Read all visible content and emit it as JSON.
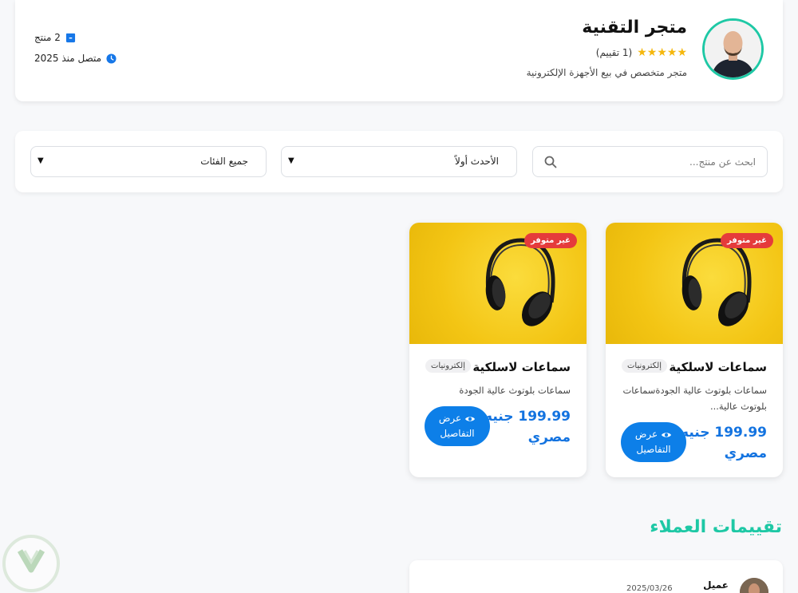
{
  "store": {
    "name": "متجر التقنية",
    "rating_count": "(1 تقييم)",
    "stars": "★★★★★",
    "description": "متجر متخصص في بيع الأجهزة الإلكترونية",
    "products_count": "2 منتج",
    "joined": "متصل منذ 2025",
    "accent_color": "#1ec8a5"
  },
  "filters": {
    "search_placeholder": "ابحث عن منتج...",
    "sort_selected": "الأحدث أولاً",
    "category_selected": "جميع الفئات"
  },
  "products": [
    {
      "badge": "غير متوفر",
      "title": "سماعات لاسلكية",
      "category": "إلكترونيات",
      "description": "سماعات بلوتوث عالية الجودةسماعات بلوتوث عالية...",
      "price": "199.99 جنيه مصري",
      "details_label_line1": "عرض",
      "details_label_line2": "التفاصيل"
    },
    {
      "badge": "غير متوفر",
      "title": "سماعات لاسلكية",
      "category": "إلكترونيات",
      "description": "سماعات بلوتوث عالية الجودة",
      "price": "199.99 جنيه مصري",
      "details_label_line1": "عرض",
      "details_label_line2": "التفاصيل"
    }
  ],
  "reviews": {
    "title": "تقييمات العملاء",
    "items": [
      {
        "name": "عميل",
        "date": "2025/03/26"
      }
    ]
  },
  "colors": {
    "primary": "#0d7fe8",
    "price": "#1373e0",
    "badge": "#e53b3b",
    "star": "#f5b70d"
  }
}
